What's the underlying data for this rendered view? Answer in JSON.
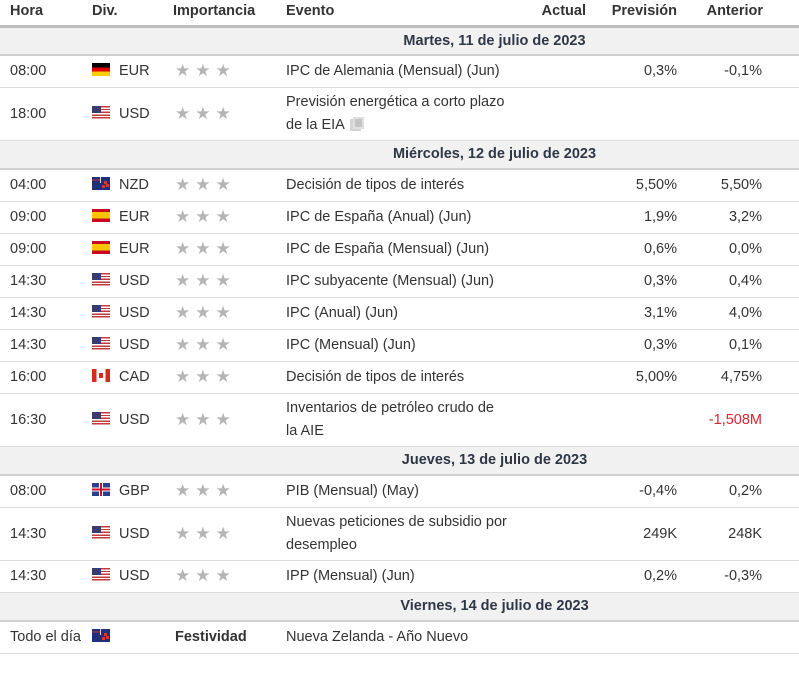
{
  "header": {
    "hora": "Hora",
    "div": "Div.",
    "importancia": "Importancia",
    "evento": "Evento",
    "actual": "Actual",
    "prevision": "Previsión",
    "anterior": "Anterior"
  },
  "days": [
    {
      "label": "Martes, 11 de julio de 2023",
      "events": [
        {
          "hora": "08:00",
          "flag": "de",
          "currency": "EUR",
          "stars": 3,
          "event": "IPC de Alemania (Mensual) (Jun)",
          "actual": "",
          "prevision": "0,3%",
          "anterior": "-0,1%",
          "anterior_color": "#333333",
          "has_doc_icon": false
        },
        {
          "hora": "18:00",
          "flag": "us",
          "currency": "USD",
          "stars": 3,
          "event": "Previsión energética a corto plazo de la EIA",
          "actual": "",
          "prevision": "",
          "anterior": "",
          "anterior_color": "#333333",
          "has_doc_icon": true
        }
      ]
    },
    {
      "label": "Miércoles, 12 de julio de 2023",
      "events": [
        {
          "hora": "04:00",
          "flag": "nz",
          "currency": "NZD",
          "stars": 3,
          "event": "Decisión de tipos de interés",
          "actual": "",
          "prevision": "5,50%",
          "anterior": "5,50%",
          "anterior_color": "#333333"
        },
        {
          "hora": "09:00",
          "flag": "es",
          "currency": "EUR",
          "stars": 3,
          "event": "IPC de España (Anual) (Jun)",
          "actual": "",
          "prevision": "1,9%",
          "anterior": "3,2%",
          "anterior_color": "#333333"
        },
        {
          "hora": "09:00",
          "flag": "es",
          "currency": "EUR",
          "stars": 3,
          "event": "IPC de España (Mensual) (Jun)",
          "actual": "",
          "prevision": "0,6%",
          "anterior": "0,0%",
          "anterior_color": "#333333"
        },
        {
          "hora": "14:30",
          "flag": "us",
          "currency": "USD",
          "stars": 3,
          "event": "IPC subyacente (Mensual) (Jun)",
          "actual": "",
          "prevision": "0,3%",
          "anterior": "0,4%",
          "anterior_color": "#333333"
        },
        {
          "hora": "14:30",
          "flag": "us",
          "currency": "USD",
          "stars": 3,
          "event": "IPC (Anual) (Jun)",
          "actual": "",
          "prevision": "3,1%",
          "anterior": "4,0%",
          "anterior_color": "#333333"
        },
        {
          "hora": "14:30",
          "flag": "us",
          "currency": "USD",
          "stars": 3,
          "event": "IPC (Mensual) (Jun)",
          "actual": "",
          "prevision": "0,3%",
          "anterior": "0,1%",
          "anterior_color": "#333333"
        },
        {
          "hora": "16:00",
          "flag": "ca",
          "currency": "CAD",
          "stars": 3,
          "event": "Decisión de tipos de interés",
          "actual": "",
          "prevision": "5,00%",
          "anterior": "4,75%",
          "anterior_color": "#333333"
        },
        {
          "hora": "16:30",
          "flag": "us",
          "currency": "USD",
          "stars": 3,
          "event": "Inventarios de petróleo crudo de la AIE",
          "actual": "",
          "prevision": "",
          "anterior": "-1,508M",
          "anterior_color": "#d8262f"
        }
      ]
    },
    {
      "label": "Jueves, 13 de julio de 2023",
      "events": [
        {
          "hora": "08:00",
          "flag": "gb",
          "currency": "GBP",
          "stars": 3,
          "event": "PIB (Mensual) (May)",
          "actual": "",
          "prevision": "-0,4%",
          "anterior": "0,2%",
          "anterior_color": "#333333"
        },
        {
          "hora": "14:30",
          "flag": "us",
          "currency": "USD",
          "stars": 3,
          "event": "Nuevas peticiones de subsidio por desempleo",
          "actual": "",
          "prevision": "249K",
          "anterior": "248K",
          "anterior_color": "#333333"
        },
        {
          "hora": "14:30",
          "flag": "us",
          "currency": "USD",
          "stars": 3,
          "event": "IPP (Mensual) (Jun)",
          "actual": "",
          "prevision": "0,2%",
          "anterior": "-0,3%",
          "anterior_color": "#333333"
        }
      ]
    },
    {
      "label": "Viernes, 14 de julio de 2023",
      "events": [
        {
          "hora": "Todo el día",
          "flag": "nz",
          "currency": "",
          "holiday": "Festividad",
          "event": "Nueva Zelanda - Año Nuevo",
          "actual": "",
          "prevision": "",
          "anterior": ""
        }
      ]
    }
  ]
}
